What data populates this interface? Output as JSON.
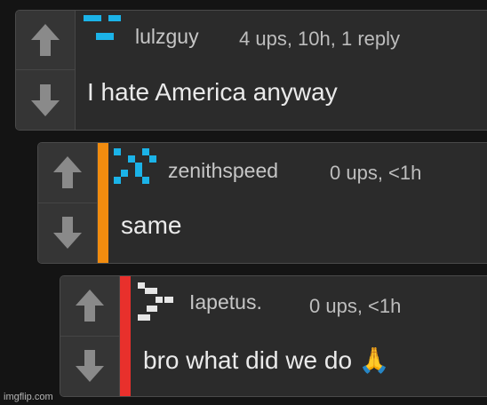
{
  "comments": [
    {
      "username": "lulzguy",
      "meta": "4 ups, 10h, 1 reply",
      "text": "I hate America anyway",
      "avatar": "pixel-avatar-icon",
      "thread_color": ""
    },
    {
      "username": "zenithspeed",
      "meta": "0 ups, <1h",
      "text": "same",
      "avatar": "pixel-avatar-icon",
      "thread_color": "#f28c0f"
    },
    {
      "username": "Iapetus.",
      "meta": "0 ups, <1h",
      "text": "bro what did we do 🙏",
      "avatar": "pixel-avatar-icon",
      "thread_color": "#e8302c"
    }
  ],
  "colors": {
    "upvote_arrow": "#8a8a8a",
    "avatar_cyan": "#1bb3e8",
    "avatar_white": "#e6e6e6",
    "reply_bar_level1": "#f28c0f",
    "reply_bar_level2": "#e8302c"
  },
  "watermark": "imgflip.com"
}
